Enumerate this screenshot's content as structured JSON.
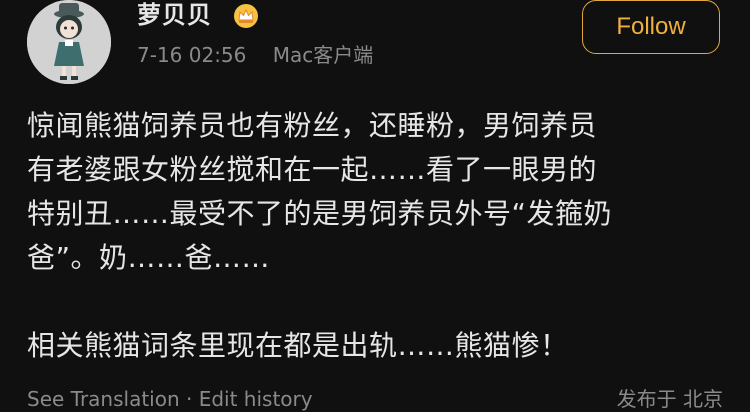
{
  "user": {
    "name": "萝贝贝",
    "time": "7-16 02:56",
    "source": "Mac客户端"
  },
  "follow_label": "Follow",
  "post": {
    "lines": [
      "惊闻熊猫饲养员也有粉丝，还睡粉，男饲养员",
      "有老婆跟女粉丝搅和在一起……看了一眼男的",
      "特别丑……最受不了的是男饲养员外号“发箍奶",
      "爸”。奶……爸……"
    ],
    "last_line": "相关熊猫词条里现在都是出轨……熊猫惨！"
  },
  "footer": {
    "left": "See Translation · Edit history",
    "right": "发布于 北京"
  },
  "colors": {
    "background": "#101010",
    "accent": "#f0b040",
    "text": "#e6e6e6",
    "muted": "#8a8a8a"
  },
  "icons": {
    "badge": "crown-icon"
  }
}
